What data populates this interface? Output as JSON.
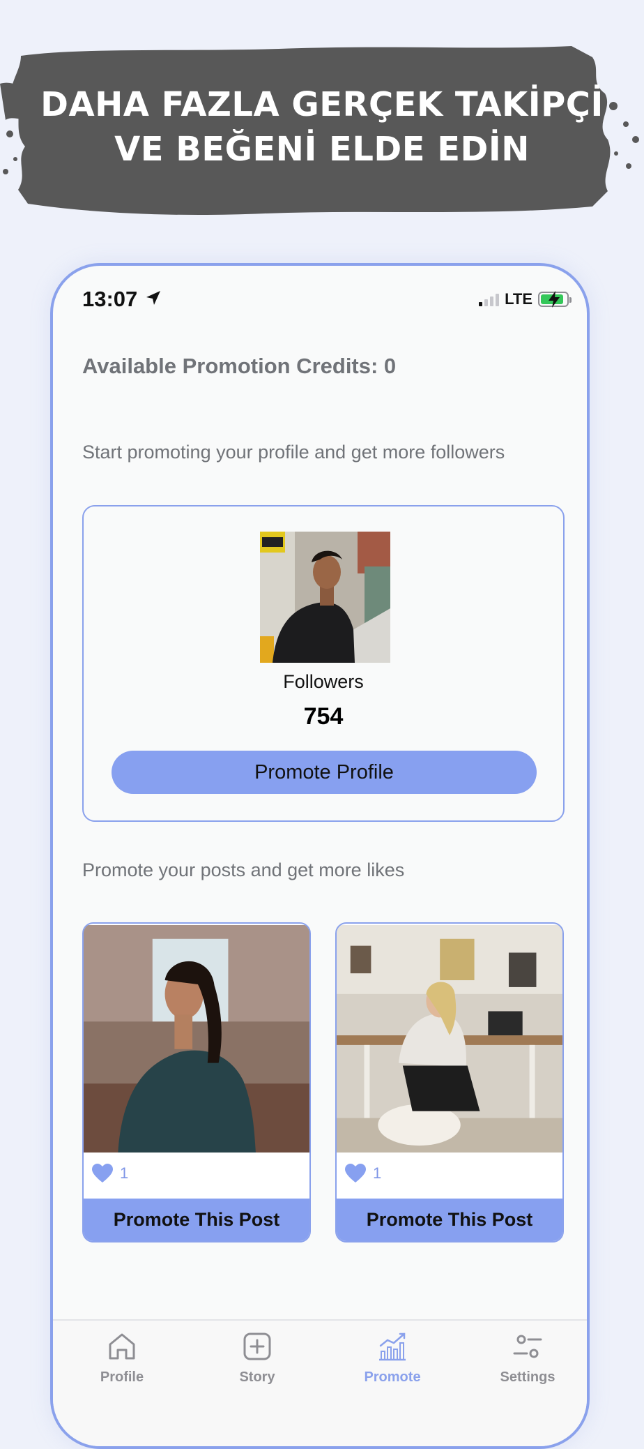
{
  "banner": {
    "line1": "DAHA FAZLA GERÇEK TAKİPÇİ",
    "line2": "VE BEĞENİ ELDE EDİN",
    "background_color": "#585858"
  },
  "status_bar": {
    "time": "13:07",
    "network": "LTE"
  },
  "promote": {
    "credits_text": "Available Promotion Credits: 0",
    "profile_intro": "Start promoting your profile and get more followers",
    "profile_card": {
      "followers_label": "Followers",
      "followers_count": "754",
      "button_label": "Promote Profile"
    },
    "posts_intro": "Promote your posts and get more likes",
    "posts": [
      {
        "likes": "1",
        "button_label": "Promote This Post"
      },
      {
        "likes": "1",
        "button_label": "Promote This Post"
      }
    ]
  },
  "tab_bar": {
    "tabs": [
      {
        "label": "Profile",
        "icon": "home-icon"
      },
      {
        "label": "Story",
        "icon": "plus-square-icon"
      },
      {
        "label": "Promote",
        "icon": "chart-icon",
        "active": true
      },
      {
        "label": "Settings",
        "icon": "sliders-icon"
      }
    ]
  },
  "colors": {
    "accent": "#87a0f0",
    "border": "#8aa1ec",
    "muted_text": "#707378",
    "page_background": "#eef1fa"
  }
}
